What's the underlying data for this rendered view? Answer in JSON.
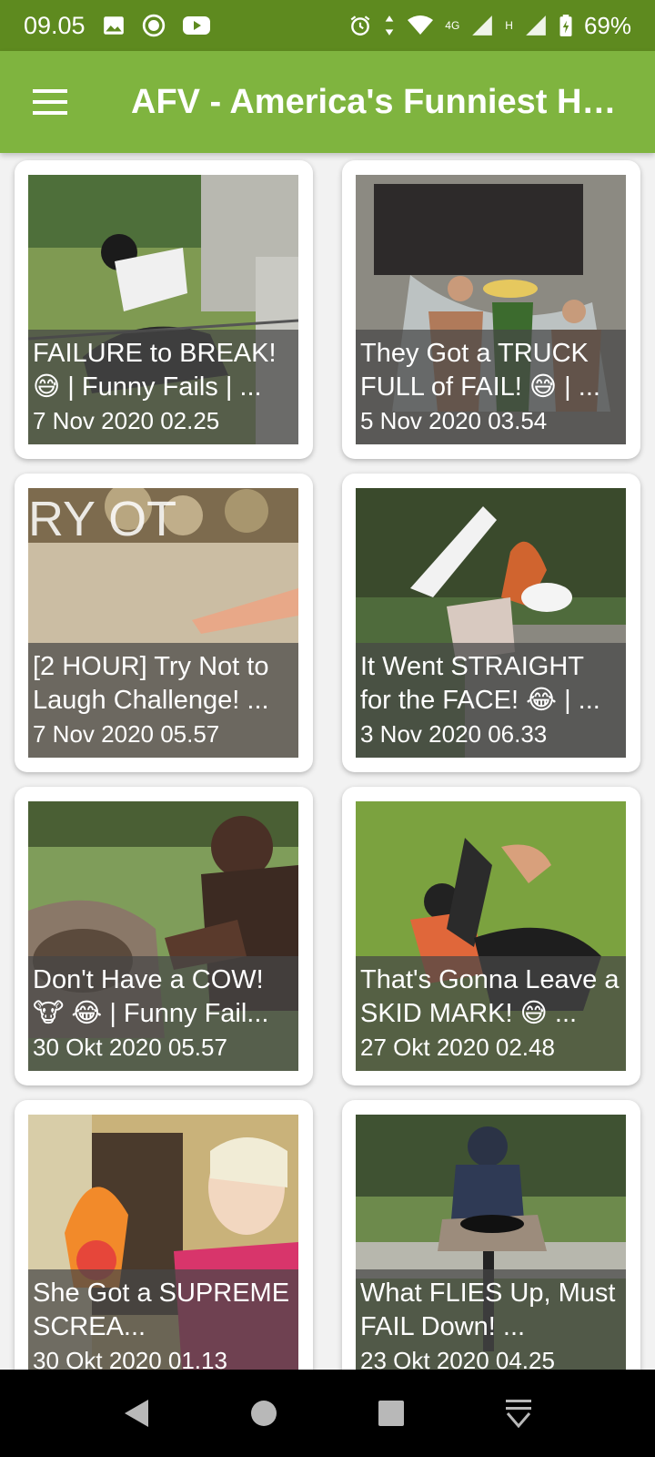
{
  "status_bar": {
    "time": "09.05",
    "network_label": "4G",
    "network_h": "H",
    "battery": "69%",
    "icons": [
      "image-icon",
      "record-icon",
      "youtube-icon",
      "alarm-icon",
      "data-arrows-icon",
      "wifi-icon",
      "signal-icon",
      "battery-icon"
    ]
  },
  "app_bar": {
    "title": "AFV - America's Funniest Ho..."
  },
  "videos": [
    {
      "title": "FAILURE to BREAK! 😅 | Funny Fails | ...",
      "date": "7 Nov 2020 02.25"
    },
    {
      "title": "They Got a TRUCK FULL of FAIL! 😅 | ...",
      "date": "5 Nov 2020 03.54"
    },
    {
      "title": "[2 HOUR] Try Not to Laugh Challenge! ...",
      "date": "7 Nov 2020 05.57"
    },
    {
      "title": "It Went STRAIGHT for the FACE! 😂 | ...",
      "date": "3 Nov 2020 06.33"
    },
    {
      "title": "Don't Have a COW! 🐮 😂 | Funny Fail...",
      "date": "30 Okt 2020 05.57"
    },
    {
      "title": "That's Gonna Leave a SKID MARK! 😅 ...",
      "date": "27 Okt 2020 02.48"
    },
    {
      "title": "She Got a SUPREME SCREA...",
      "date": "30 Okt 2020 01.13"
    },
    {
      "title": "What FLIES Up, Must FAIL Down! ...",
      "date": "23 Okt 2020 04.25"
    }
  ],
  "thumbnail_text": {
    "video3": "RY OT"
  },
  "colors": {
    "status_bar": "#5e8a1f",
    "app_bar": "#7fb43f"
  }
}
